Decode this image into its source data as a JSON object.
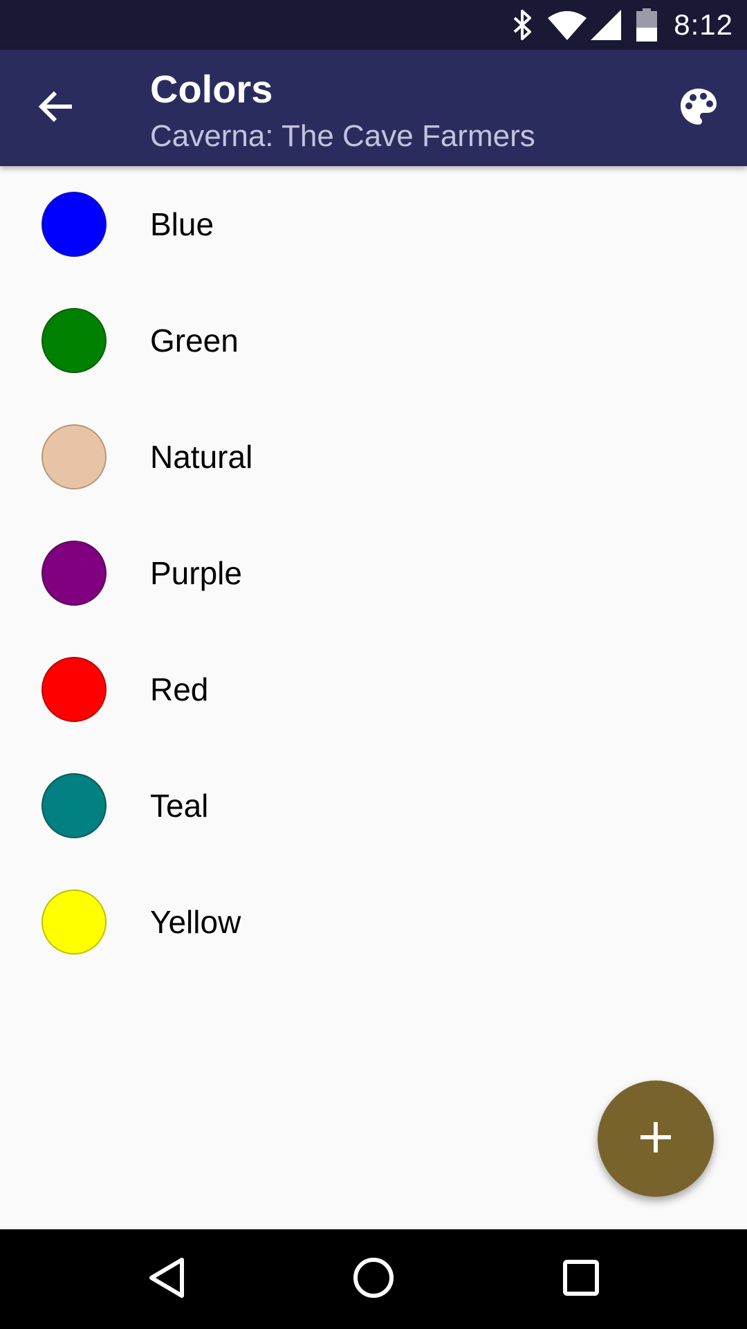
{
  "status_bar": {
    "time": "8:12",
    "icons": [
      "bluetooth-icon",
      "wifi-icon",
      "cellular-signal-icon",
      "battery-icon"
    ]
  },
  "app_bar": {
    "title": "Colors",
    "subtitle": "Caverna: The Cave Farmers",
    "back_icon": "arrow-back-icon",
    "action_icon": "palette-icon"
  },
  "colors": [
    {
      "name": "Blue",
      "fill": "#0000ff",
      "border": "#1010c0"
    },
    {
      "name": "Green",
      "fill": "#008000",
      "border": "#0a5f0a"
    },
    {
      "name": "Natural",
      "fill": "#e8c4a6",
      "border": "#b8957a"
    },
    {
      "name": "Purple",
      "fill": "#800080",
      "border": "#5c0a5c"
    },
    {
      "name": "Red",
      "fill": "#ff0000",
      "border": "#c00000"
    },
    {
      "name": "Teal",
      "fill": "#008080",
      "border": "#0a5c5c"
    },
    {
      "name": "Yellow",
      "fill": "#ffff00",
      "border": "#c0c000"
    }
  ],
  "fab": {
    "icon": "add-icon",
    "color": "#79632d"
  },
  "nav_bar": {
    "icons": [
      "back-triangle-icon",
      "home-circle-icon",
      "recents-square-icon"
    ]
  },
  "theme": {
    "status_bar": "#191936",
    "app_bar": "#2b2c5e",
    "background": "#fafafa"
  }
}
